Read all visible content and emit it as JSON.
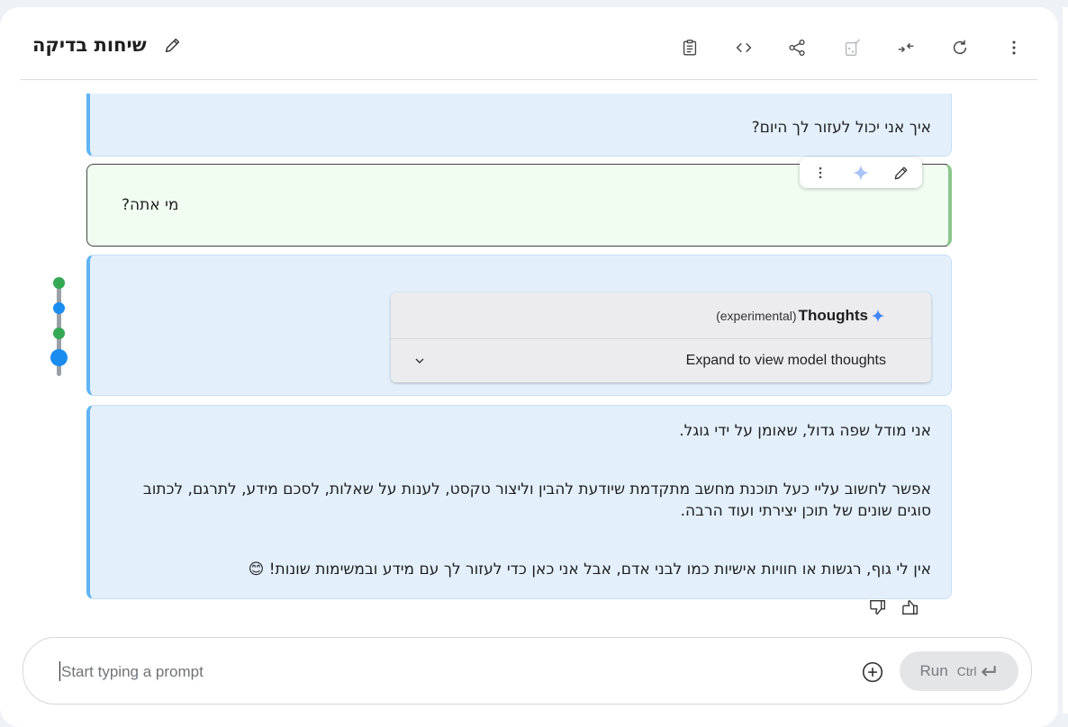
{
  "header": {
    "title": "שיחות בדיקה",
    "icons": [
      "edit-title-icon",
      "clipboard-icon",
      "code-icon",
      "share-icon",
      "compare-icon",
      "compress-icon",
      "refresh-icon",
      "more-vert-icon"
    ]
  },
  "messages": [
    {
      "role": "model",
      "text": "איך אני יכול לעזור לך היום?"
    },
    {
      "role": "user",
      "text": "מי אתה?"
    },
    {
      "role": "model",
      "thoughts": {
        "title": "Thoughts",
        "tag": "(experimental)",
        "expand_label": "Expand to view model thoughts"
      }
    },
    {
      "role": "model",
      "paragraphs": [
        "אני מודל שפה גדול, שאומן על ידי גוגל.",
        "אפשר לחשוב עליי כעל תוכנת מחשב מתקדמת שיודעת להבין וליצור טקסט, לענות על שאלות, לסכם מידע, לתרגם, לכתוב סוגים שונים של תוכן יצירתי ועוד הרבה.",
        "אין לי גוף, רגשות או חוויות אישיות כמו לבני אדם, אבל אני כאן כדי לעזור לך עם מידע ובמשימות שונות! 😊"
      ]
    }
  ],
  "colors": {
    "model_bg": "#e3f0fc",
    "model_border": "#60b4f5",
    "user_bg": "#f2fdf2",
    "timeline_green": "#34a853",
    "timeline_blue": "#1a8cf0",
    "sparkle": "#4285f4"
  },
  "prompt": {
    "placeholder": "Start typing a prompt",
    "run_label": "Run",
    "shortcut": "Ctrl"
  }
}
